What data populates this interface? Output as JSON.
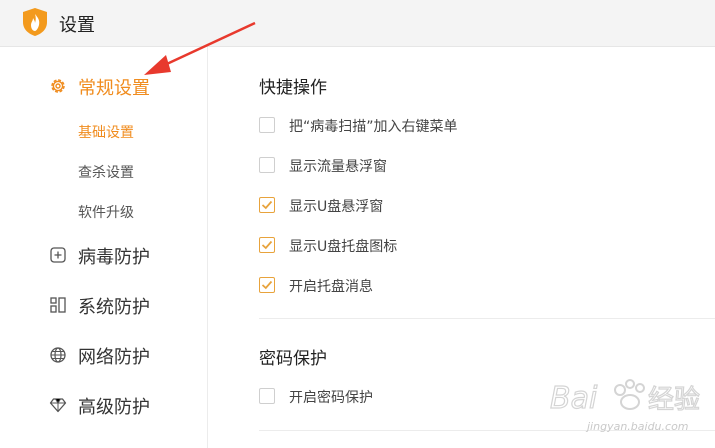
{
  "window": {
    "title": "设置"
  },
  "sidebar": {
    "items": [
      {
        "label": "常规设置",
        "icon": "gear-icon",
        "active": true
      },
      {
        "label": "病毒防护",
        "icon": "plus-square-icon",
        "active": false
      },
      {
        "label": "系统防护",
        "icon": "grid-icon",
        "active": false
      },
      {
        "label": "网络防护",
        "icon": "globe-icon",
        "active": false
      },
      {
        "label": "高级防护",
        "icon": "diamond-icon",
        "active": false
      }
    ],
    "subitems": [
      {
        "label": "基础设置",
        "active": true
      },
      {
        "label": "查杀设置",
        "active": false
      },
      {
        "label": "软件升级",
        "active": false
      }
    ]
  },
  "main": {
    "sections": [
      {
        "title": "快捷操作",
        "options": [
          {
            "label": "把“病毒扫描”加入右键菜单",
            "checked": false
          },
          {
            "label": "显示流量悬浮窗",
            "checked": false
          },
          {
            "label": "显示U盘悬浮窗",
            "checked": true
          },
          {
            "label": "显示U盘托盘图标",
            "checked": true
          },
          {
            "label": "开启托盘消息",
            "checked": true
          }
        ]
      },
      {
        "title": "密码保护",
        "options": [
          {
            "label": "开启密码保护",
            "checked": false
          }
        ]
      }
    ]
  },
  "watermark": {
    "text": "jingyan.baidu.com"
  },
  "colors": {
    "accent": "#f08c1e",
    "check": "#e8a33c",
    "arrow": "#e8392d"
  }
}
